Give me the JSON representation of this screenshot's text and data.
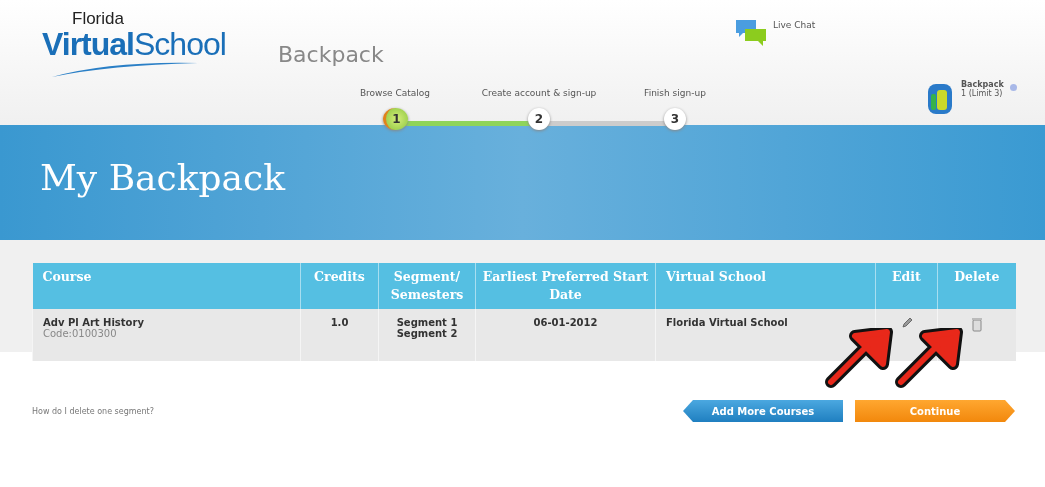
{
  "logo": {
    "top": "Florida",
    "main": "**Virtual**School"
  },
  "app_title": "Backpack",
  "live_chat": "Live Chat",
  "steps": [
    {
      "number": "1",
      "label": "Browse Catalog",
      "completed": true
    },
    {
      "number": "2",
      "label": "Create account & sign-up",
      "completed": false
    },
    {
      "number": "3",
      "label": "Finish sign-up",
      "completed": false
    }
  ],
  "backpack": {
    "label": "Backpack",
    "count": "1 (Limit 3)"
  },
  "page_title": "My Backpack",
  "table": {
    "columns": [
      "Course",
      "Credits",
      "Segment/ Semesters",
      "Earliest Preferred Start Date",
      "Virtual School",
      "Edit",
      "Delete"
    ],
    "rows": [
      {
        "course": "Adv Pl Art History",
        "code": "Code:0100300",
        "credits": "1.0",
        "segments": [
          "Segment 1",
          "Segment 2"
        ],
        "start_date": "06-01-2012",
        "school": "Florida Virtual School"
      }
    ]
  },
  "help_link": "How do I delete one segment?",
  "buttons": {
    "back": "Add More Courses",
    "next": "Continue"
  }
}
